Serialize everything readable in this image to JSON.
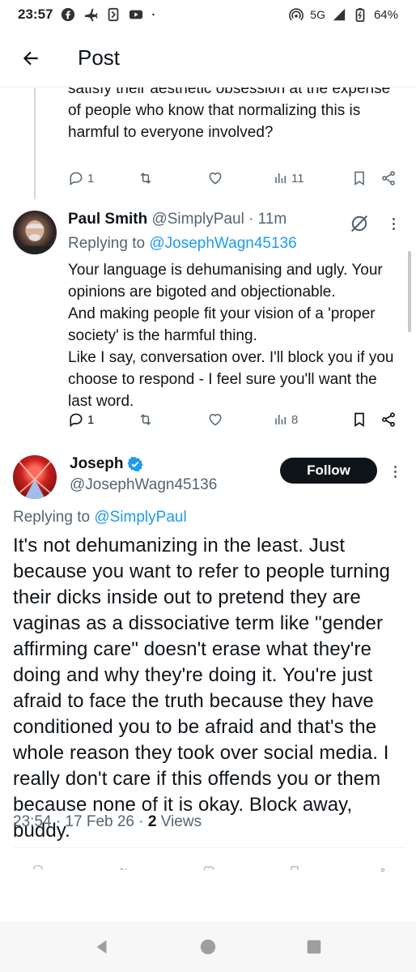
{
  "status_bar": {
    "time": "23:57",
    "network": "5G",
    "battery": "64%",
    "left_icons": [
      "facebook-icon",
      "airplane-icon",
      "app-icon",
      "youtube-icon",
      "dot-icon"
    ],
    "right_icons": [
      "hotspot-icon",
      "signal-icon",
      "battery-icon"
    ]
  },
  "header": {
    "title": "Post"
  },
  "reply1": {
    "text": "satisfy their aesthetic obsession at the expense of people who know that normalizing this is harmful to everyone involved?",
    "reply_count": "1",
    "views": "11"
  },
  "reply2": {
    "name": "Paul Smith",
    "handle": "@SimplyPaul",
    "time": "· 11m",
    "replying_prefix": "Replying to ",
    "replying_to": "@JosephWagn45136",
    "text": "Your language is dehumanising and ugly. Your opinions are bigoted and objectionable.\nAnd making people fit your vision of a 'proper society' is the harmful thing.\nLike I say, conversation over. I'll block you if you choose to respond - I feel sure you'll want the last word.",
    "reply_count": "1",
    "views": "8"
  },
  "main_post": {
    "name": "Joseph",
    "handle": "@JosephWagn45136",
    "follow_label": "Follow",
    "replying_prefix": "Replying to ",
    "replying_to": "@SimplyPaul",
    "text": "It's not dehumanizing in the least. Just because you want to refer to people turning their dicks inside out to pretend they are vaginas as a dissociative term like \"gender affirming care\" doesn't erase what they're doing and why they're doing it. You're just afraid to face the truth because they have conditioned you to be afraid and that's the whole reason they took over social media. I really don't care if this offends you or them because none of it is okay. Block away, buddy.",
    "timestamp": "23:54 · 17 Feb 26 · ",
    "views_count": "2",
    "views_label": " Views"
  },
  "colors": {
    "accent": "#1d9bf0",
    "text": "#0f1419",
    "muted": "#536471",
    "divider": "#eff3f4"
  }
}
